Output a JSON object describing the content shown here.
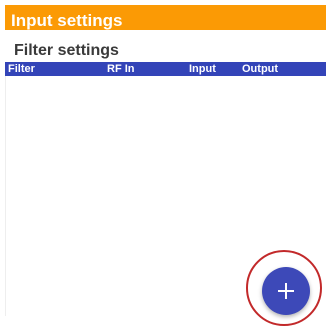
{
  "header": {
    "title": "Input settings",
    "background_color": "#fb9a05"
  },
  "filter_section": {
    "title": "Filter settings",
    "table": {
      "columns": [
        "Filter",
        "RF In",
        "Input",
        "Output"
      ],
      "header_color": "#3344b8",
      "rows": []
    }
  },
  "fab": {
    "icon": "plus-icon",
    "color": "#3d49b8"
  },
  "highlight_color": "#c2292a"
}
